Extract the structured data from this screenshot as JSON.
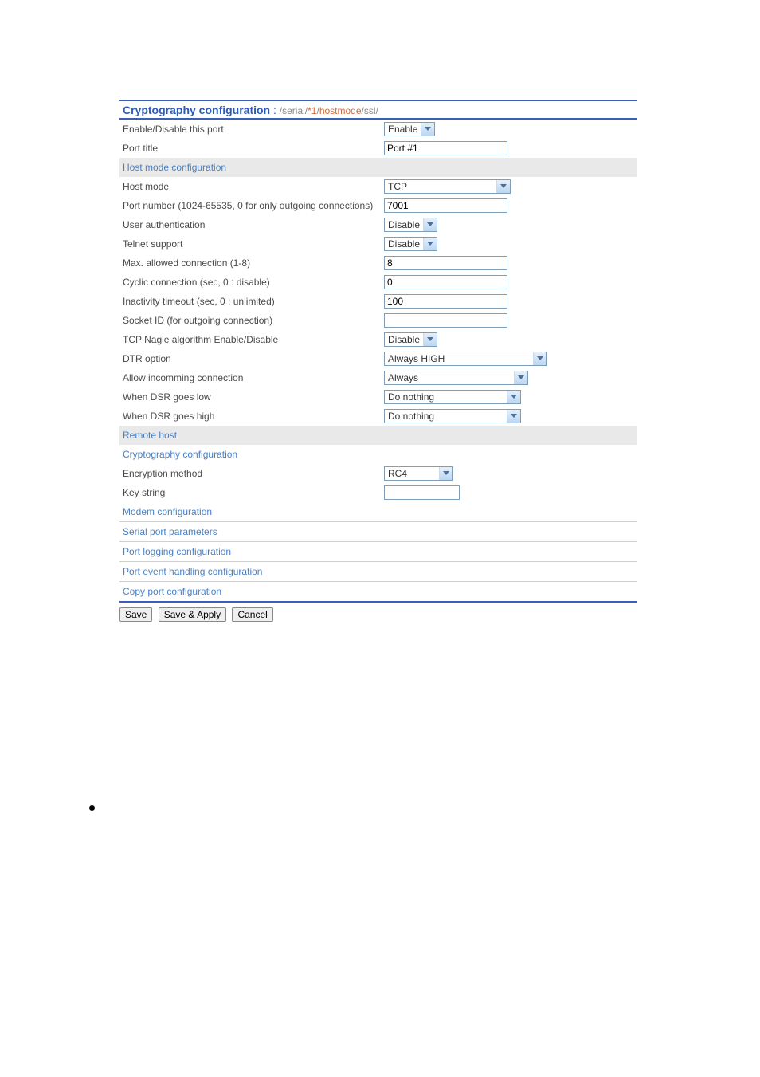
{
  "title": {
    "main": "Cryptography configuration",
    "sep": " : ",
    "crumb_plain1": "/serial/",
    "crumb_hl1": "*1",
    "crumb_plain2": "/",
    "crumb_hl2": "hostmode",
    "crumb_plain3": "/ssl/"
  },
  "rows": {
    "enable_label": "Enable/Disable this port",
    "enable_value": "Enable",
    "porttitle_label": "Port title",
    "porttitle_value": "Port #1",
    "hostmode_section": "Host mode configuration",
    "hostmode_label": "Host mode",
    "hostmode_value": "TCP",
    "portnum_label": "Port number (1024-65535, 0 for only outgoing connections)",
    "portnum_value": "7001",
    "userauth_label": "User authentication",
    "userauth_value": "Disable",
    "telnet_label": "Telnet support",
    "telnet_value": "Disable",
    "maxconn_label": "Max. allowed connection (1-8)",
    "maxconn_value": "8",
    "cyclic_label": "Cyclic connection (sec, 0 : disable)",
    "cyclic_value": "0",
    "inactivity_label": "Inactivity timeout (sec, 0 : unlimited)",
    "inactivity_value": "100",
    "socketid_label": "Socket ID (for outgoing connection)",
    "socketid_value": "",
    "nagle_label": "TCP Nagle algorithm Enable/Disable",
    "nagle_value": "Disable",
    "dtr_label": "DTR option",
    "dtr_value": "Always HIGH",
    "allowin_label": "Allow incomming connection",
    "allowin_value": "Always",
    "dsrlow_label": "When DSR goes low",
    "dsrlow_value": "Do nothing",
    "dsrhigh_label": "When DSR goes high",
    "dsrhigh_value": "Do nothing",
    "remote_section": "Remote host",
    "crypto_section": "Cryptography configuration",
    "encmethod_label": "Encryption method",
    "encmethod_value": "RC4",
    "keystr_label": "Key string",
    "keystr_value": "",
    "modem_section": "Modem configuration",
    "nav_serial": "Serial port parameters",
    "nav_logging": "Port logging configuration",
    "nav_event": "Port event handling configuration",
    "nav_copy": "Copy port configuration"
  },
  "widths": {
    "enable_select": "48px",
    "porttitle_input": "155px",
    "hostmode_select": "132px",
    "portnum_input": "155px",
    "userauth_select": "45px",
    "telnet_select": "45px",
    "maxconn_input": "155px",
    "cyclic_input": "155px",
    "inactivity_input": "155px",
    "socketid_input": "155px",
    "nagle_select": "45px",
    "dtr_select": "178px",
    "allowin_select": "154px",
    "dsrlow_select": "145px",
    "dsrhigh_select": "145px",
    "encmethod_select": "60px",
    "keystr_input": "95px"
  },
  "buttons": {
    "save": "Save",
    "save_apply": "Save & Apply",
    "cancel": "Cancel"
  }
}
